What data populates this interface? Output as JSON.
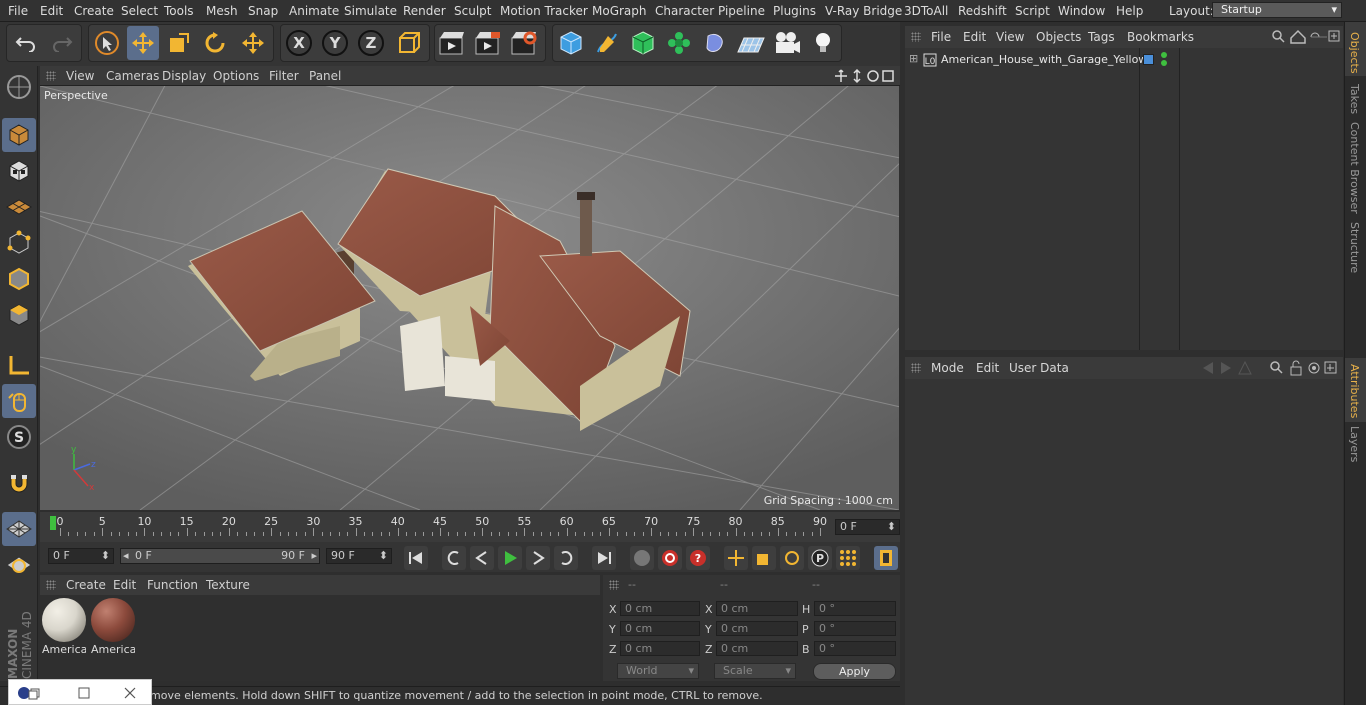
{
  "menu": {
    "items": [
      "File",
      "Edit",
      "Create",
      "Select",
      "Tools",
      "Mesh",
      "Snap",
      "Animate",
      "Simulate",
      "Render",
      "Sculpt",
      "Motion Tracker",
      "MoGraph",
      "Character",
      "Pipeline",
      "Plugins",
      "V-Ray Bridge",
      "3DToAll",
      "Redshift",
      "Script",
      "Window",
      "Help"
    ],
    "layout_label": "Layout:",
    "layout_value": "Startup"
  },
  "toolbar": {
    "icons": [
      "undo-icon",
      "redo-icon",
      "live-selection-icon",
      "move-icon",
      "scale-icon",
      "rotate-icon",
      "recent-tool-icon",
      "x-axis-icon",
      "y-axis-icon",
      "z-axis-icon",
      "coordinate-system-icon",
      "render-view-icon",
      "render-picture-viewer-icon",
      "edit-render-settings-icon",
      "cube-icon",
      "pen-icon",
      "subdivision-icon",
      "cloner-icon",
      "deformer-icon",
      "floor-icon",
      "camera-icon",
      "light-icon"
    ],
    "axis_x": "X",
    "axis_y": "Y",
    "axis_z": "Z"
  },
  "viewport": {
    "menu": [
      "View",
      "Cameras",
      "Display",
      "Options",
      "Filter",
      "Panel"
    ],
    "label": "Perspective",
    "grid_spacing": "Grid Spacing : 1000 cm"
  },
  "timeline": {
    "labels": [
      "0",
      "5",
      "10",
      "15",
      "20",
      "25",
      "30",
      "35",
      "40",
      "45",
      "50",
      "55",
      "60",
      "65",
      "70",
      "75",
      "80",
      "85",
      "90"
    ],
    "current_frame": "0 F",
    "start_field": "0 F",
    "range_start": "0 F",
    "range_end": "90 F",
    "end_field": "90 F"
  },
  "materials": {
    "menu": [
      "Create",
      "Edit",
      "Function",
      "Texture"
    ],
    "items": [
      {
        "label": "America",
        "color": "#d9d6cc"
      },
      {
        "label": "America",
        "color": "#8c4a3c"
      }
    ]
  },
  "coords": {
    "headers": [
      "--",
      "--",
      "--"
    ],
    "rows": [
      {
        "a": "X",
        "av": "0 cm",
        "b": "X",
        "bv": "0 cm",
        "c": "H",
        "cv": "0 °"
      },
      {
        "a": "Y",
        "av": "0 cm",
        "b": "Y",
        "bv": "0 cm",
        "c": "P",
        "cv": "0 °"
      },
      {
        "a": "Z",
        "av": "0 cm",
        "b": "Z",
        "bv": "0 cm",
        "c": "B",
        "cv": "0 °"
      }
    ],
    "world": "World",
    "scale": "Scale",
    "apply": "Apply"
  },
  "status": {
    "text": "move elements. Hold down SHIFT to quantize movement / add to the selection in point mode, CTRL to remove."
  },
  "object_manager": {
    "menu": [
      "File",
      "Edit",
      "View",
      "Objects",
      "Tags",
      "Bookmarks"
    ],
    "objects": [
      {
        "name": "American_House_with_Garage_Yellow"
      }
    ]
  },
  "attributes": {
    "menu": [
      "Mode",
      "Edit",
      "User Data"
    ]
  },
  "side_tabs": [
    "Objects",
    "Takes",
    "Content Browser",
    "Structure",
    "Attributes",
    "Layers"
  ],
  "brand": {
    "line1": "MAXON",
    "line2": "CINEMA 4D"
  },
  "colors": {
    "accent": "#5b6e8c",
    "tab_active": "#e8b14a",
    "play_green": "#3fbf3f"
  }
}
